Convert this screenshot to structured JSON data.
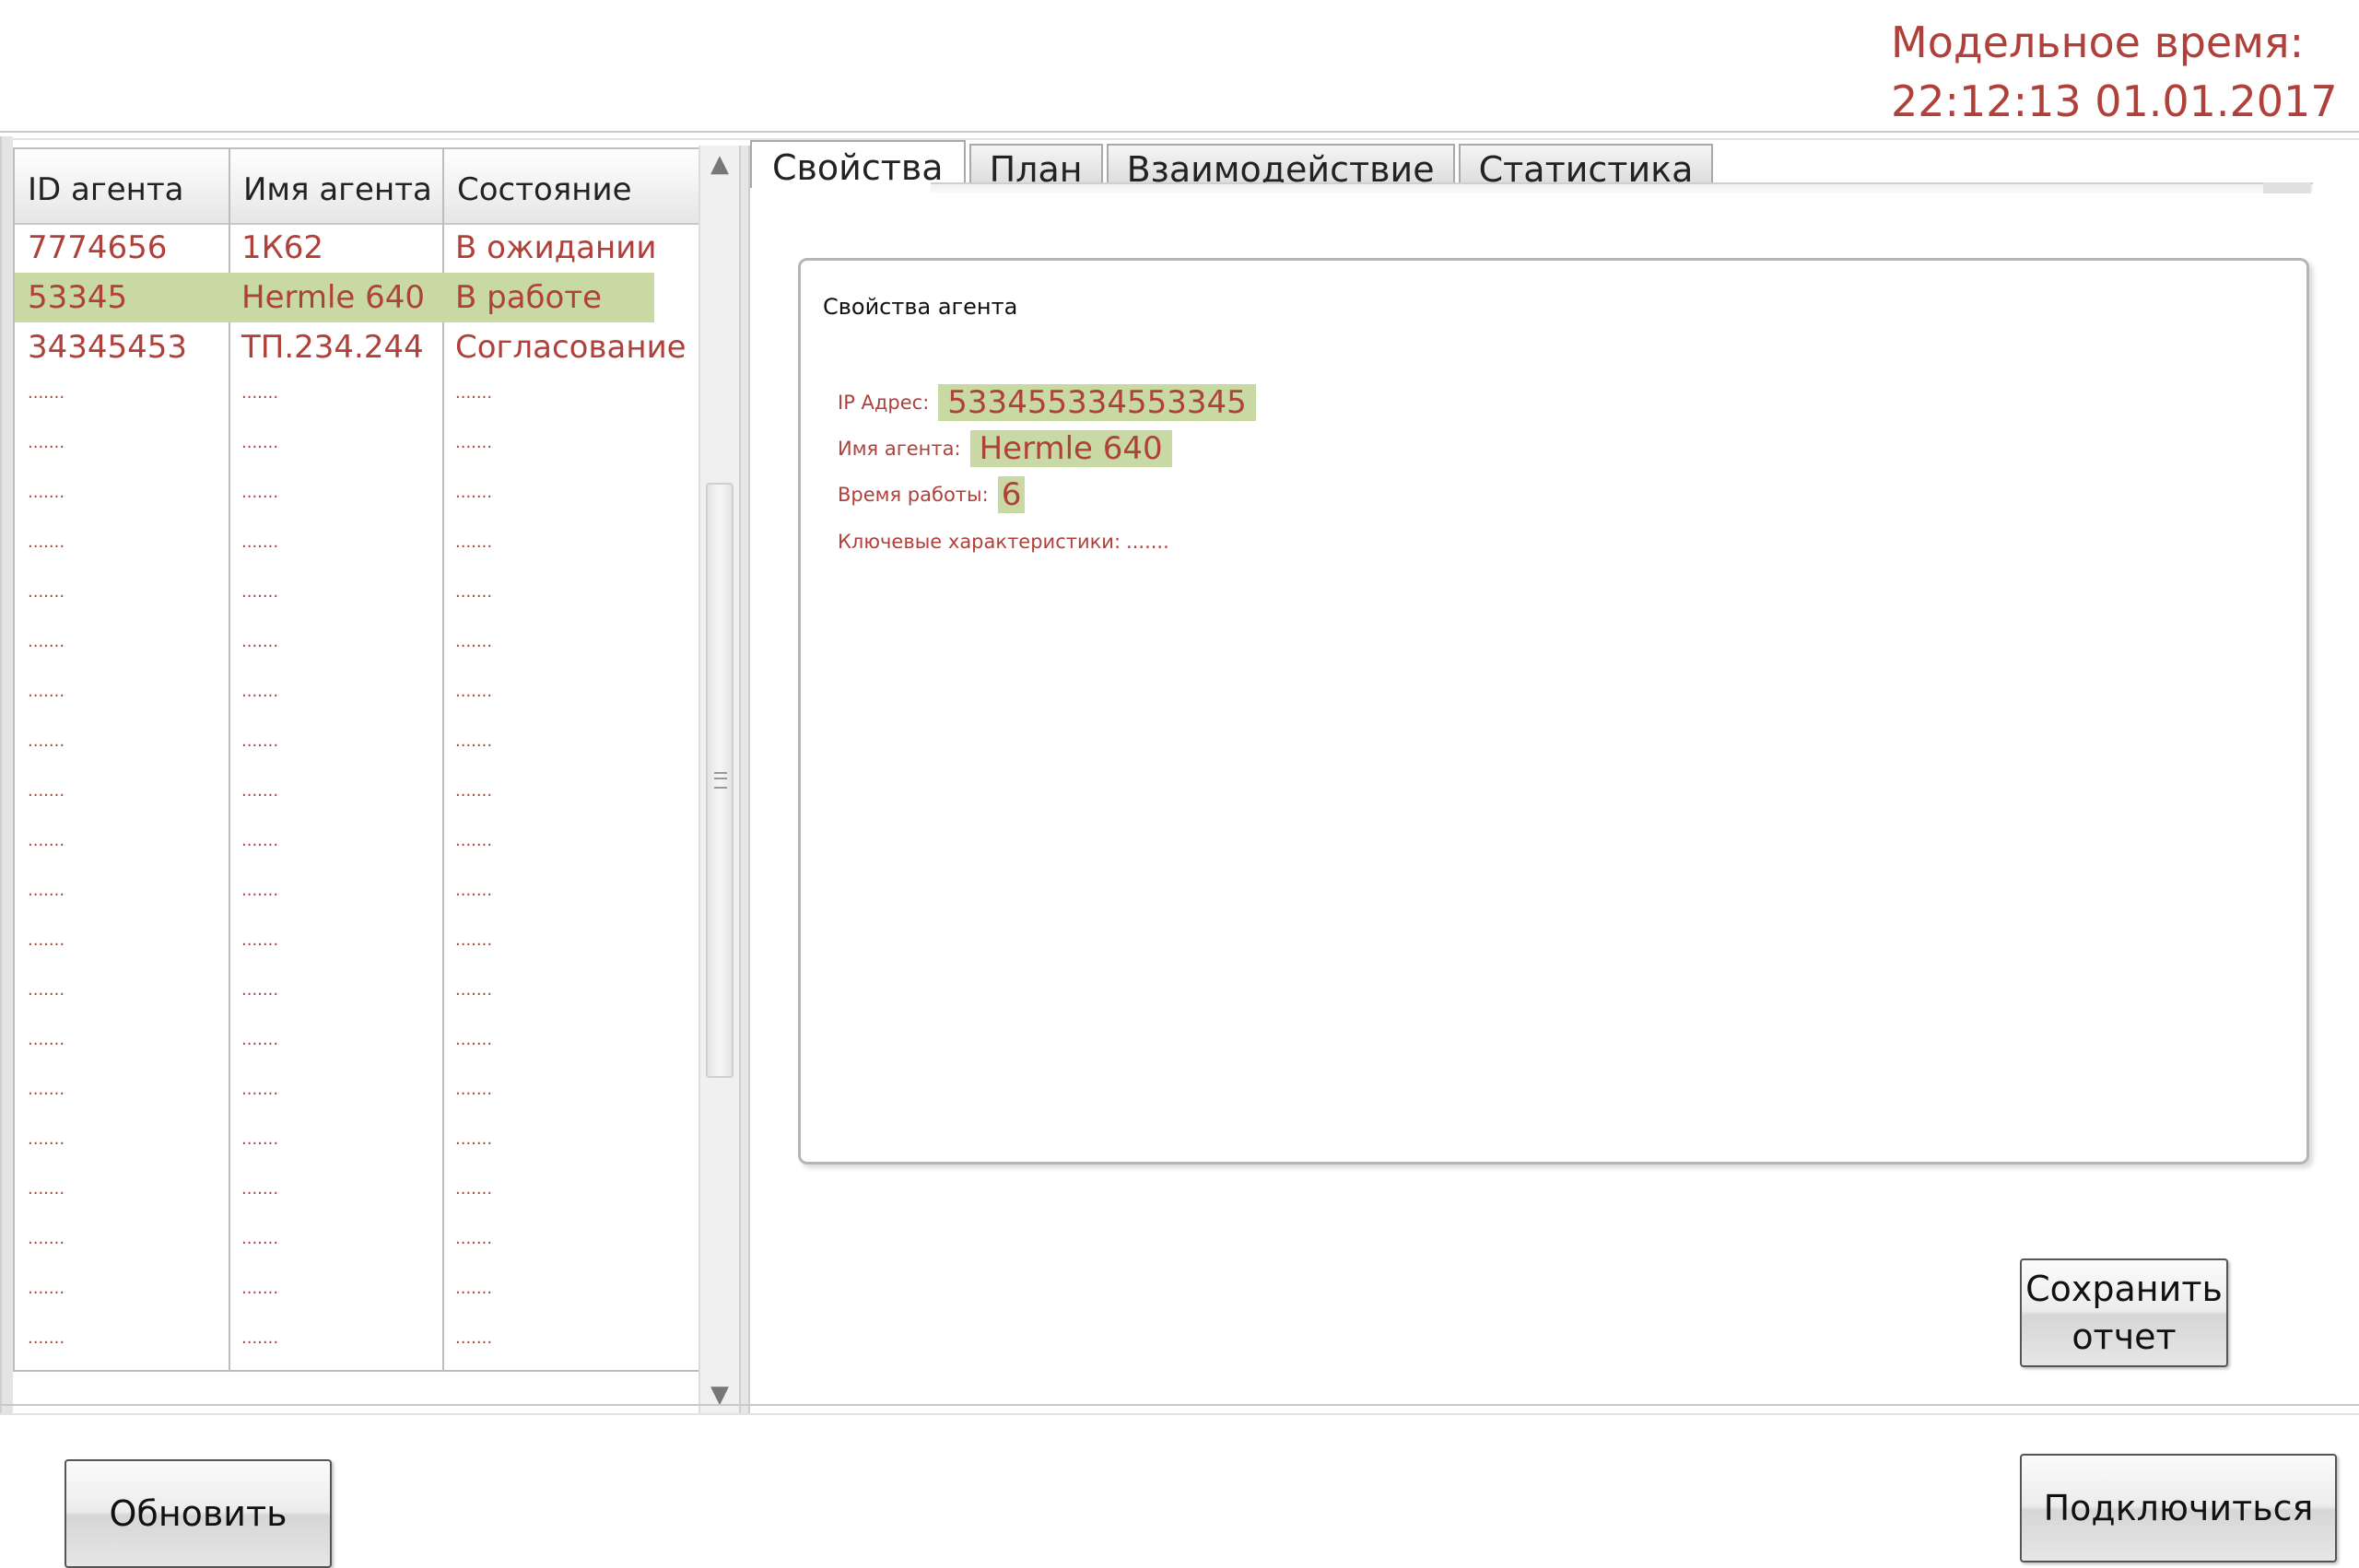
{
  "header": {
    "model_time_label": "Модельное время:",
    "model_time_value": "22:12:13 01.01.2017"
  },
  "agents_table": {
    "columns": [
      "ID агента",
      "Имя агента",
      "Состояние"
    ],
    "rows": [
      [
        "7774656",
        "1К62",
        "В ожидании"
      ],
      [
        "53345",
        "Hermle 640",
        "В работе"
      ],
      [
        "34345453",
        "ТП.234.244",
        "Согласование"
      ]
    ],
    "selected_row": 1,
    "placeholder": "......."
  },
  "tabs": [
    {
      "label": "Свойства",
      "active": true
    },
    {
      "label": "План",
      "active": false
    },
    {
      "label": "Взаимодействие",
      "active": false
    },
    {
      "label": "Статистика",
      "active": false
    }
  ],
  "properties": {
    "title": "Свойства агента",
    "ip_label": "IP Адрес:",
    "ip_value": "533455334553345",
    "name_label": "Имя агента:",
    "name_value": "Hermle 640",
    "uptime_label": "Время работы:",
    "uptime_value": "6",
    "key_label": "Ключевые характеристики:",
    "key_value": "......."
  },
  "buttons": {
    "save_line1": "Сохранить",
    "save_line2": "отчет",
    "refresh": "Обновить",
    "connect": "Подключиться"
  },
  "icons": {
    "scroll_up": "triangle-up-icon",
    "scroll_down": "triangle-down-icon",
    "scroll_grip": "grip-icon"
  },
  "colors": {
    "accent_text": "#b0403a",
    "highlight": "#c8d9a3"
  }
}
